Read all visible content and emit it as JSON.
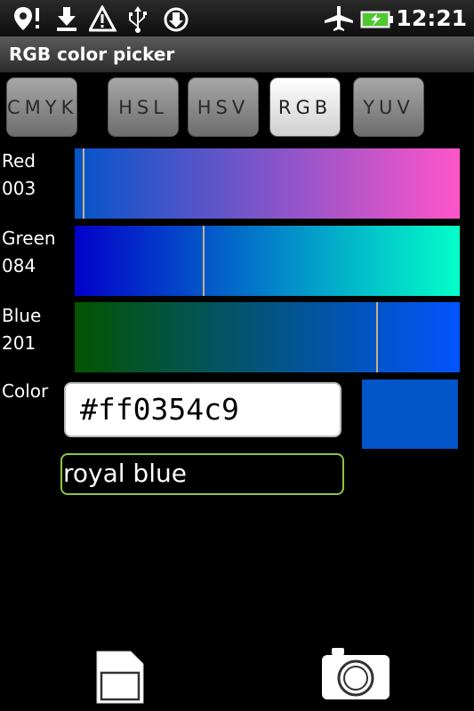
{
  "status_bar": {
    "time": "12:21",
    "icons": [
      "location-alert-icon",
      "download-icon",
      "warning-icon",
      "usb-icon",
      "sync-icon",
      "airplane-mode-icon",
      "battery-charging-icon"
    ]
  },
  "app": {
    "title": "RGB color picker"
  },
  "tabs": [
    {
      "label": "CMYK",
      "active": false
    },
    {
      "label": "HSL",
      "active": false
    },
    {
      "label": "HSV",
      "active": false
    },
    {
      "label": "RGB",
      "active": true
    },
    {
      "label": "YUV",
      "active": false
    }
  ],
  "channels": [
    {
      "name": "Red",
      "value": "003",
      "level": 3,
      "gradient": [
        "#0355c9",
        "#ff55c9"
      ]
    },
    {
      "name": "Green",
      "value": "084",
      "level": 84,
      "gradient": [
        "#0300c9",
        "#03ffc9"
      ]
    },
    {
      "name": "Blue",
      "value": "201",
      "level": 201,
      "gradient": [
        "#035400",
        "#0354ff"
      ]
    }
  ],
  "color": {
    "label": "Color",
    "hex": "#ff0354c9",
    "swatch": "#0354c9",
    "name": "royal blue"
  },
  "bottom_actions": [
    "sd-card-icon",
    "camera-icon"
  ]
}
